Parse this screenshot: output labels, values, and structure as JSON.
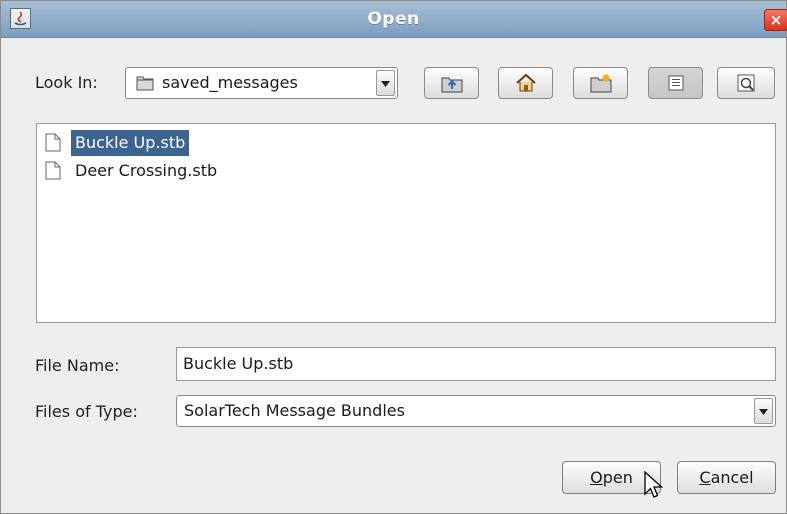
{
  "window": {
    "title": "Open",
    "close_glyph": "×"
  },
  "look_in": {
    "label": "Look In:",
    "selected": "saved_messages",
    "folder_icon": "folder-icon"
  },
  "toolbar": {
    "buttons": [
      {
        "name": "up-one-level-icon"
      },
      {
        "name": "home-icon"
      },
      {
        "name": "new-folder-icon"
      },
      {
        "name": "list-view-icon",
        "selected": true
      },
      {
        "name": "details-view-icon"
      }
    ]
  },
  "files": [
    {
      "name": "Buckle Up.stb",
      "selected": true
    },
    {
      "name": "Deer Crossing.stb",
      "selected": false
    }
  ],
  "file_name": {
    "label": "File Name:",
    "value": "Buckle Up.stb"
  },
  "file_type": {
    "label": "Files of Type:",
    "selected": "SolarTech Message Bundles"
  },
  "buttons": {
    "open": {
      "mnemonic": "O",
      "rest": "pen"
    },
    "cancel": {
      "mnemonic": "C",
      "rest": "ancel"
    }
  },
  "colors": {
    "title_bar": "#7d9dbd",
    "selection": "#3d6491",
    "close": "#d8331d"
  }
}
